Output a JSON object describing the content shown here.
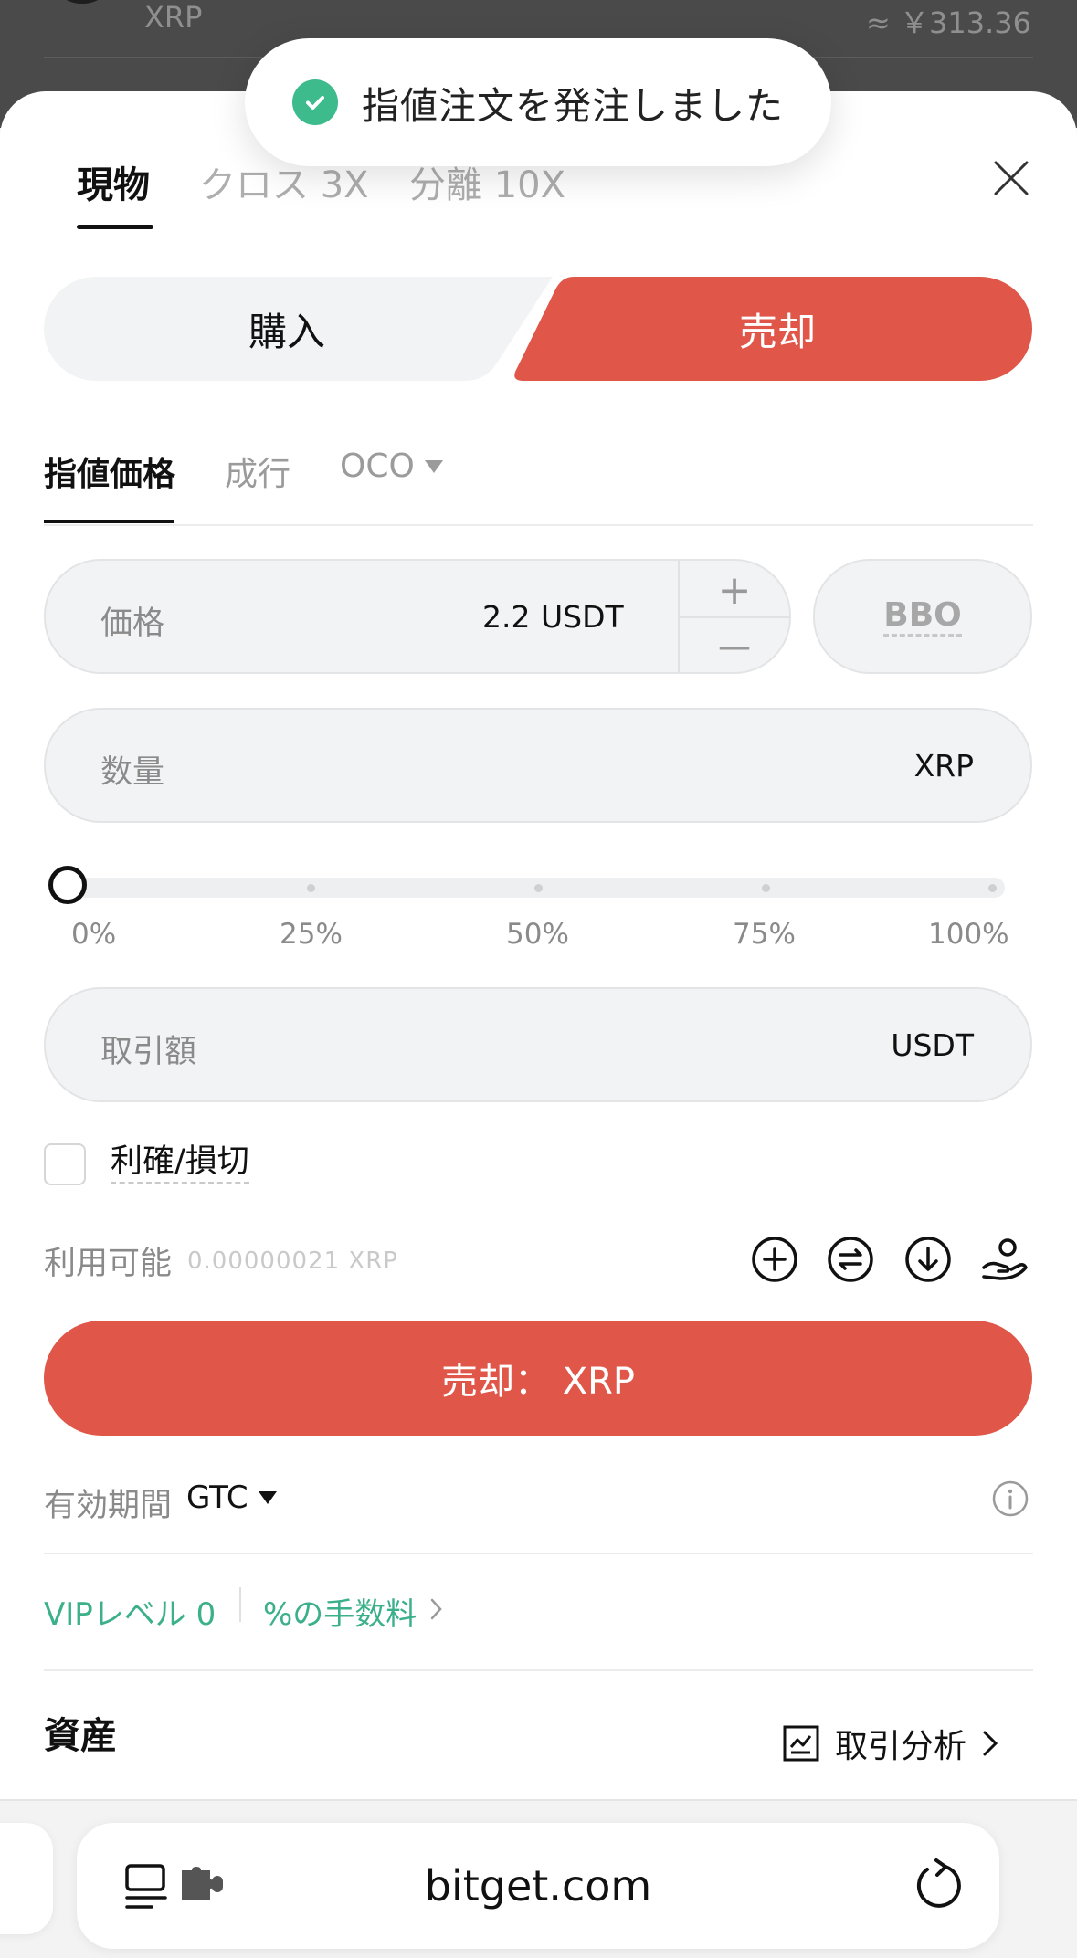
{
  "background": {
    "coin_name": "XRP",
    "coin_price": "≈ ￥313.36"
  },
  "toast": {
    "icon": "check-circle-icon",
    "message": "指値注文を発注しました"
  },
  "tabs": [
    {
      "label": "現物"
    },
    {
      "label": "クロス 3X"
    },
    {
      "label": "分離 10X"
    }
  ],
  "side": {
    "buy_label": "購入",
    "sell_label": "売却"
  },
  "order_types": [
    {
      "label": "指値価格"
    },
    {
      "label": "成行"
    },
    {
      "label": "OCO"
    }
  ],
  "price_field": {
    "label": "価格",
    "value": "2.2",
    "unit": "USDT",
    "plus": "+",
    "minus": "—"
  },
  "bbo_label": "BBO",
  "quantity_field": {
    "label": "数量",
    "unit": "XRP"
  },
  "slider": {
    "value_percent": 0,
    "labels": [
      "0%",
      "25%",
      "50%",
      "75%",
      "100%"
    ]
  },
  "amount_field": {
    "label": "取引額",
    "unit": "USDT"
  },
  "tpsl_label": "利確/損切",
  "available": {
    "label": "利用可能",
    "value": "0.00000021 XRP"
  },
  "submit_label": "売却： XRP",
  "validity": {
    "label": "有効期間",
    "value": "GTC"
  },
  "vip": {
    "level_label": "VIPレベル 0",
    "fee_label": "%の手数料"
  },
  "assets": {
    "title": "資産",
    "analysis_label": "取引分析"
  },
  "browser": {
    "domain": "bitget.com"
  },
  "colors": {
    "sell": "#E05648",
    "accent_green": "#3BB08A",
    "toast_check": "#3DBB8D"
  }
}
